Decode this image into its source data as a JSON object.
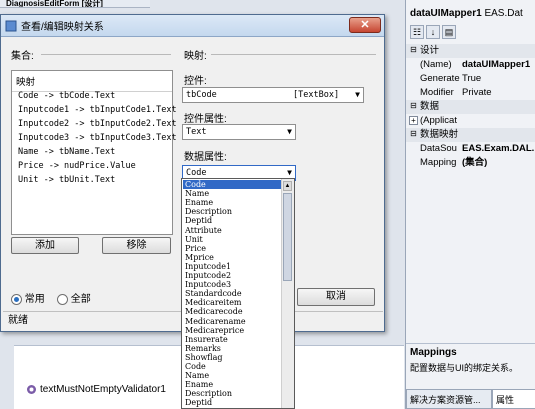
{
  "designer": {
    "tab_label": "DiagnosisEditForm [设计]",
    "validator_label": "textMustNotEmptyValidator1"
  },
  "properties": {
    "title_name": "dataUIMapper1",
    "title_type": "EAS.Dat",
    "rows": [
      {
        "kind": "cat",
        "name": "设计"
      },
      {
        "kind": "prop",
        "name": "(Name)",
        "value": "dataUIMapper1",
        "bold": true
      },
      {
        "kind": "prop",
        "name": "Generate",
        "value": "True"
      },
      {
        "kind": "prop",
        "name": "Modifier",
        "value": "Private"
      },
      {
        "kind": "cat",
        "name": "数据"
      },
      {
        "kind": "prop",
        "name": "(Applicat",
        "value": "",
        "expand": "+"
      },
      {
        "kind": "cat",
        "name": "数据映射"
      },
      {
        "kind": "prop",
        "name": "DataSou",
        "value": "EAS.Exam.DAL.I",
        "bold": true
      },
      {
        "kind": "prop",
        "name": "Mapping",
        "value": "(集合)",
        "bold": true
      }
    ],
    "desc_title": "Mappings",
    "desc_text": "配置数据与UI的绑定关系。",
    "tabs": [
      "解决方案资源管...",
      "属性"
    ]
  },
  "dialog": {
    "title": "查看/编辑映射关系",
    "close_glyph": "✕",
    "collection_label": "集合:",
    "mapping_label": "映射:",
    "list_header": "映射",
    "mappings": [
      "Code -> tbCode.Text",
      "Inputcode1 -> tbInputCode1.Text",
      "Inputcode2 -> tbInputCode2.Text",
      "Inputcode3 -> tbInputCode3.Text",
      "Name -> tbName.Text",
      "Price -> nudPrice.Value",
      "Unit -> tbUnit.Text"
    ],
    "add_button": "添加",
    "remove_button": "移除",
    "control_label": "控件:",
    "control_value": "tbCode",
    "control_type": "[TextBox]",
    "control_prop_label": "控件属性:",
    "control_prop_value": "Text",
    "data_prop_label": "数据属性:",
    "data_prop_value": "Code",
    "ok_button": "",
    "cancel_button": "取消",
    "radio_common": "常用",
    "radio_all": "全部",
    "status": "就绪"
  },
  "dropdown_items": [
    "Code",
    "Name",
    "Ename",
    "Description",
    "Deptid",
    "Attribute",
    "Unit",
    "Price",
    "Mprice",
    "Inputcode1",
    "Inputcode2",
    "Inputcode3",
    "Standardcode",
    "Medicareitem",
    "Medicarecode",
    "Medicarename",
    "Medicareprice",
    "Insurerate",
    "Remarks",
    "Showflag",
    "Code",
    "Name",
    "Ename",
    "Description",
    "Deptid"
  ],
  "colors": {
    "selection": "#3169c6",
    "close_button": "#c64632"
  }
}
